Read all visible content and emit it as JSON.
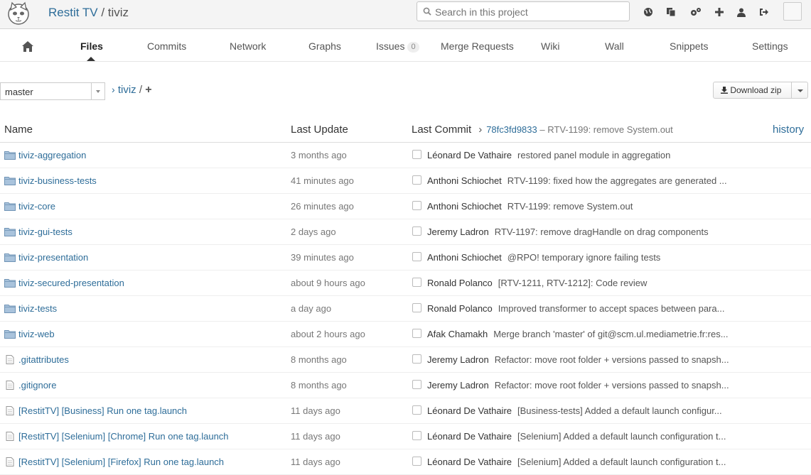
{
  "header": {
    "group": "Restit TV",
    "separator": " / ",
    "project": "tiviz",
    "search_placeholder": "Search in this project",
    "icons": [
      "globe-icon",
      "copy-icon",
      "admin-cogs-icon",
      "plus-icon",
      "user-icon",
      "sign-out-icon"
    ]
  },
  "nav": {
    "home_icon": "home-icon",
    "items": [
      {
        "label": "Files"
      },
      {
        "label": "Commits"
      },
      {
        "label": "Network"
      },
      {
        "label": "Graphs"
      },
      {
        "label": "Issues",
        "badge": "0"
      },
      {
        "label": "Merge Requests"
      },
      {
        "label": "Wiki"
      },
      {
        "label": "Wall"
      },
      {
        "label": "Snippets"
      },
      {
        "label": "Settings"
      }
    ],
    "active": "Files"
  },
  "tree": {
    "branch": "master",
    "crumb_sep": "›",
    "crumb_path": "tiviz",
    "crumb_slash": "/",
    "crumb_plus": "+",
    "download_label": "Download zip"
  },
  "table": {
    "headers": {
      "name": "Name",
      "last_update": "Last Update",
      "last_commit": "Last Commit",
      "chevron": "›",
      "commit_sha": "78fc3fd9833",
      "commit_dash": " – ",
      "commit_msg": "RTV-1199: remove System.out",
      "history": "history"
    },
    "rows": [
      {
        "type": "folder",
        "name": "tiviz-aggregation",
        "date": "3 months ago",
        "author": "Léonard De Vathaire",
        "message": "restored panel module in aggregation"
      },
      {
        "type": "folder",
        "name": "tiviz-business-tests",
        "date": "41 minutes ago",
        "author": "Anthoni Schiochet",
        "message": "RTV-1199: fixed how the aggregates are generated ..."
      },
      {
        "type": "folder",
        "name": "tiviz-core",
        "date": "26 minutes ago",
        "author": "Anthoni Schiochet",
        "message": "RTV-1199: remove System.out"
      },
      {
        "type": "folder",
        "name": "tiviz-gui-tests",
        "date": "2 days ago",
        "author": "Jeremy Ladron",
        "message": "RTV-1197: remove dragHandle on drag components"
      },
      {
        "type": "folder",
        "name": "tiviz-presentation",
        "date": "39 minutes ago",
        "author": "Anthoni Schiochet",
        "message": "@RPO! temporary ignore failing tests"
      },
      {
        "type": "folder",
        "name": "tiviz-secured-presentation",
        "date": "about 9 hours ago",
        "author": "Ronald Polanco",
        "message": "[RTV-1211, RTV-1212]: Code review"
      },
      {
        "type": "folder",
        "name": "tiviz-tests",
        "date": "a day ago",
        "author": "Ronald Polanco",
        "message": "Improved transformer to accept spaces between para..."
      },
      {
        "type": "folder",
        "name": "tiviz-web",
        "date": "about 2 hours ago",
        "author": "Afak Chamakh",
        "message": "Merge branch 'master' of git@scm.ul.mediametrie.fr:res..."
      },
      {
        "type": "file",
        "name": ".gitattributes",
        "date": "8 months ago",
        "author": "Jeremy Ladron",
        "message": "Refactor: move root folder + versions passed to snapsh..."
      },
      {
        "type": "file",
        "name": ".gitignore",
        "date": "8 months ago",
        "author": "Jeremy Ladron",
        "message": "Refactor: move root folder + versions passed to snapsh..."
      },
      {
        "type": "file",
        "name": "[RestitTV] [Business] Run one tag.launch",
        "date": "11 days ago",
        "author": "Léonard De Vathaire",
        "message": "[Business-tests] Added a default launch configur..."
      },
      {
        "type": "file",
        "name": "[RestitTV] [Selenium] [Chrome] Run one tag.launch",
        "date": "11 days ago",
        "author": "Léonard De Vathaire",
        "message": "[Selenium] Added a default launch configuration t..."
      },
      {
        "type": "file",
        "name": "[RestitTV] [Selenium] [Firefox] Run one tag.launch",
        "date": "11 days ago",
        "author": "Léonard De Vathaire",
        "message": "[Selenium] Added a default launch configuration t..."
      }
    ]
  },
  "colors": {
    "link": "#2e6d99",
    "header_bg": "#f4f4f4"
  }
}
